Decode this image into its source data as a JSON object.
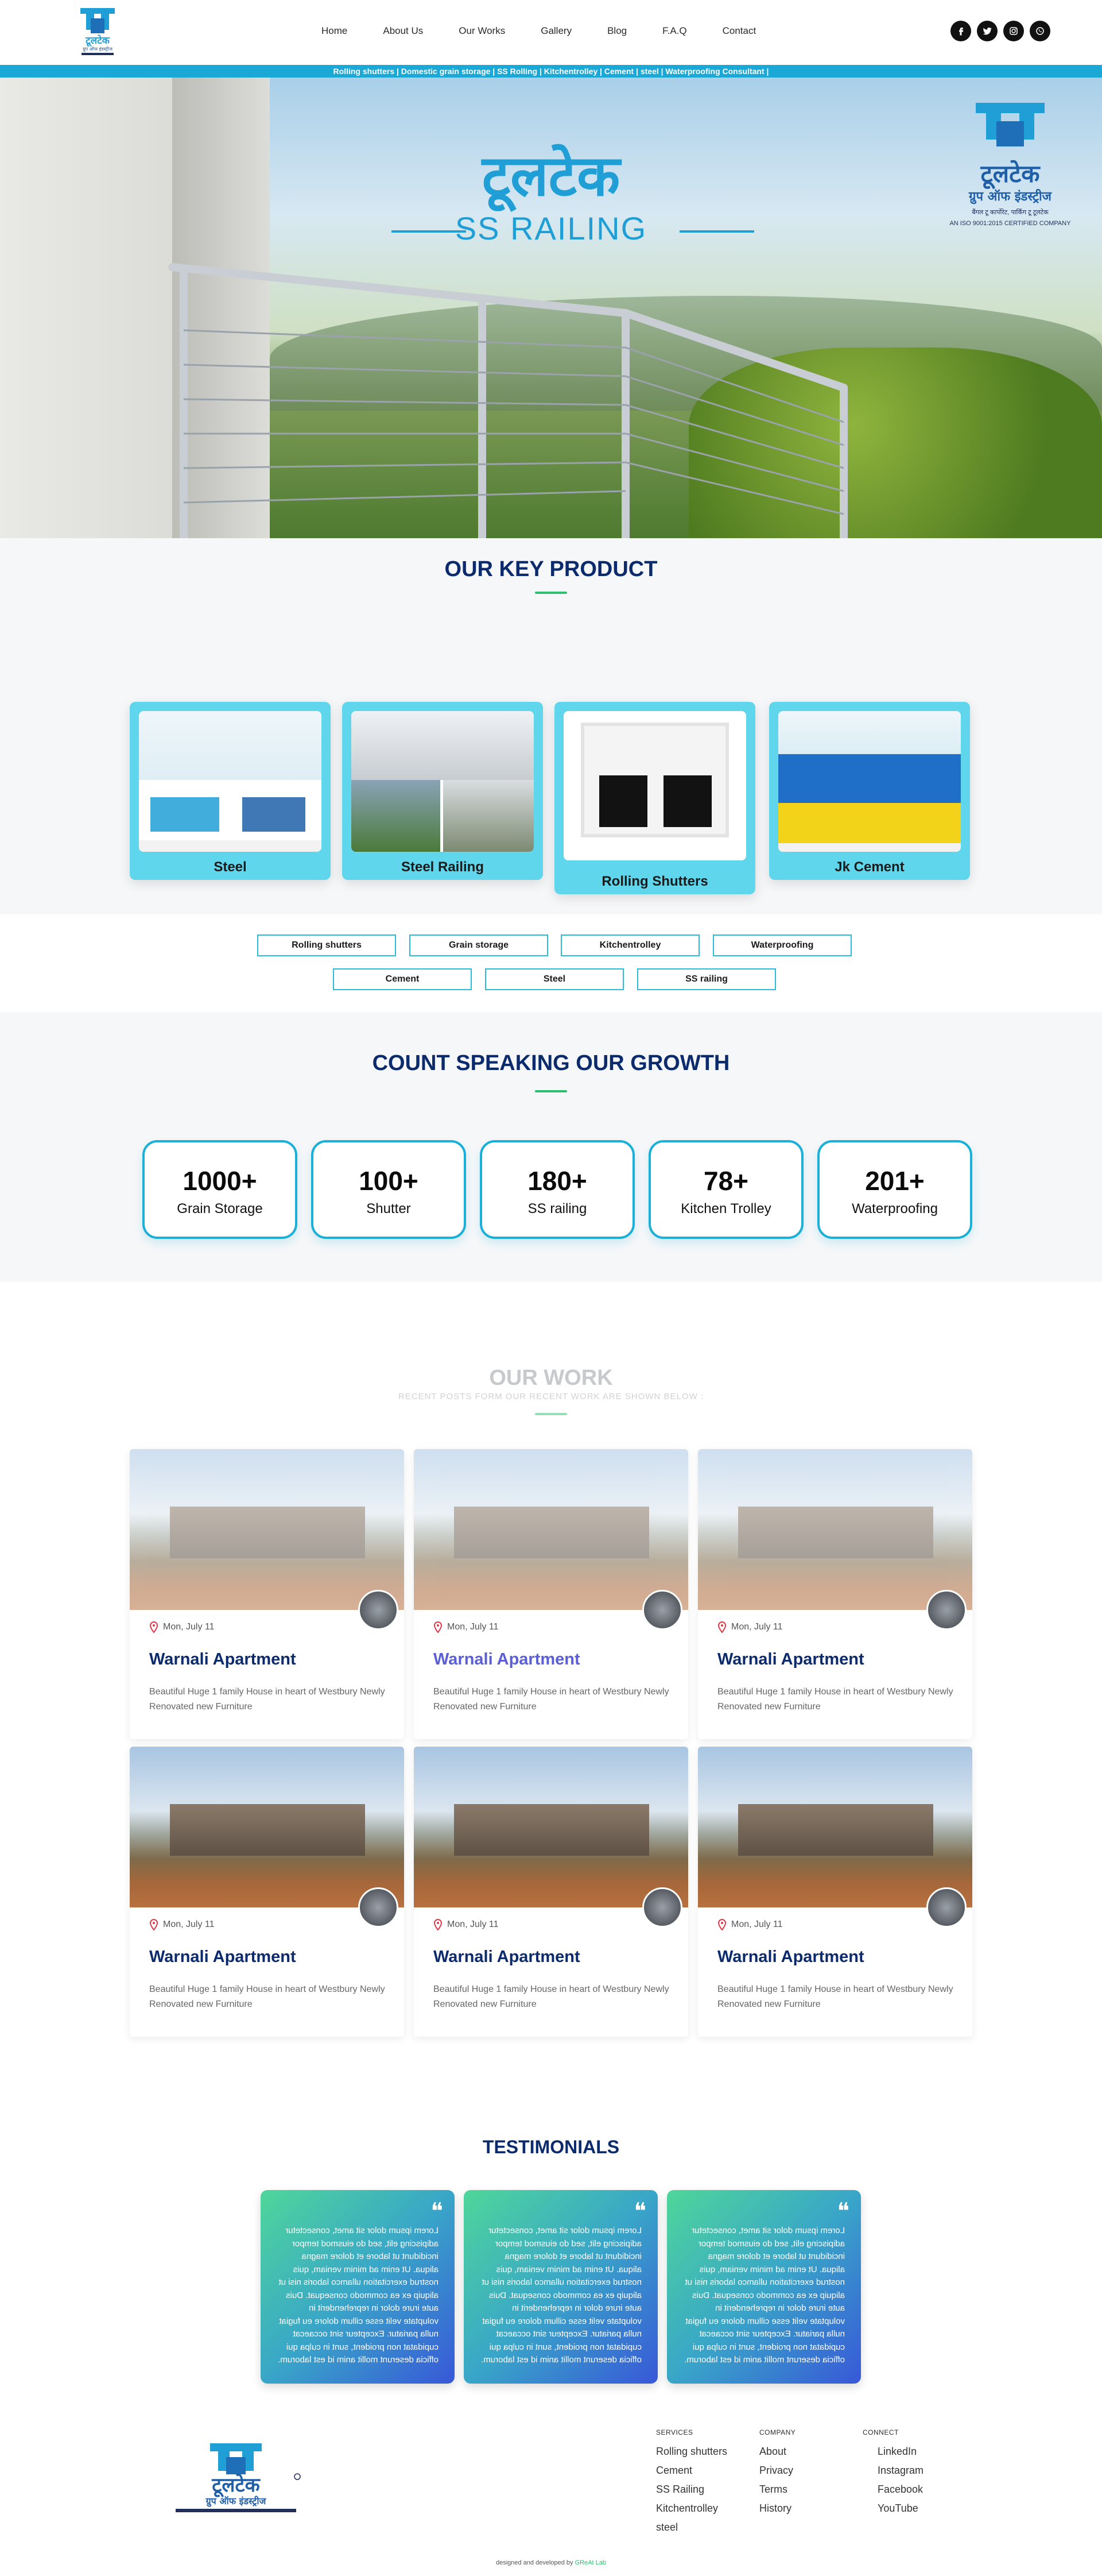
{
  "nav": {
    "items": [
      "Home",
      "About Us",
      "Our Works",
      "Gallery",
      "Blog",
      "F.A.Q",
      "Contact"
    ]
  },
  "social": {
    "icons": [
      "facebook-icon",
      "twitter-icon",
      "instagram-icon",
      "whatsapp-icon"
    ]
  },
  "ticker": {
    "text": "Rolling shutters | Domestic grain storage | SS Rolling | Kitchentrolley | Cement | steel | Waterproofing Consultant |"
  },
  "hero": {
    "title_hi": "टूलटेक",
    "title_en": "SS RAILING",
    "logo_brand_hi": "टूलटेक",
    "logo_group_hi": "ग्रुप ऑफ इंडस्ट्रीज",
    "logo_tagline": "बैंगल टू कार्पोरेट, पार्किंग टू टूलटेक",
    "logo_cert": "AN ISO 9001:2015 CERTIFIED COMPANY"
  },
  "key_product": {
    "title": "OUR KEY PRODUCT",
    "cards": [
      {
        "label": "Steel"
      },
      {
        "label": "Steel Railing"
      },
      {
        "label": "Rolling Shutters"
      },
      {
        "label": "Jk Cement"
      }
    ],
    "chips_row1": [
      "Rolling shutters",
      "Grain storage",
      "Kitchentrolley",
      "Waterproofing"
    ],
    "chips_row2": [
      "Cement",
      "Steel",
      "SS railing"
    ]
  },
  "growth": {
    "title": "COUNT SPEAKING OUR GROWTH",
    "stats": [
      {
        "num": "1000+",
        "label": "Grain Storage"
      },
      {
        "num": "100+",
        "label": "Shutter"
      },
      {
        "num": "180+",
        "label": "SS railing"
      },
      {
        "num": "78+",
        "label": "Kitchen Trolley"
      },
      {
        "num": "201+",
        "label": "Waterproofing"
      }
    ]
  },
  "work": {
    "title": "OUR WORK",
    "subtitle": "RECENT POSTS FORM OUR RECENT WORK ARE SHOWN BELOW :",
    "posts": [
      {
        "date": "Mon, July 11",
        "title": "Warnali Apartment",
        "desc": "Beautiful Huge 1 family House in heart of Westbury Newly Renovated new Furniture"
      },
      {
        "date": "Mon, July 11",
        "title": "Warnali Apartment",
        "desc": "Beautiful Huge 1 family House in heart of Westbury Newly Renovated new Furniture"
      },
      {
        "date": "Mon, July 11",
        "title": "Warnali Apartment",
        "desc": "Beautiful Huge 1 family House in heart of Westbury Newly Renovated new Furniture"
      },
      {
        "date": "Mon, July 11",
        "title": "Warnali Apartment",
        "desc": "Beautiful Huge 1 family House in heart of Westbury Newly Renovated new Furniture"
      },
      {
        "date": "Mon, July 11",
        "title": "Warnali Apartment",
        "desc": "Beautiful Huge 1 family House in heart of Westbury Newly Renovated new Furniture"
      },
      {
        "date": "Mon, July 11",
        "title": "Warnali Apartment",
        "desc": "Beautiful Huge 1 family House in heart of Westbury Newly Renovated new Furniture"
      }
    ]
  },
  "testimonials": {
    "title": "TESTIMONIALS",
    "items": [
      {
        "text": "Lorem ipsum dolor sit amet, consectetur adipiscing elit, sed do eiusmod tempor incididunt ut labore et dolore magna aliqua. Ut enim ad minim veniam, quis nostrud exercitation ullamco laboris nisi ut aliquip ex ea commodo consequat. Duis aute irure dolor in reprehenderit in voluptate velit esse cillum dolore eu fugiat nulla pariatur. Excepteur sint occaecat cupidatat non proident, sunt in culpa qui officia deserunt mollit anim id est laborum."
      },
      {
        "text": "Lorem ipsum dolor sit amet, consectetur adipiscing elit, sed do eiusmod tempor incididunt ut labore et dolore magna aliqua. Ut enim ad minim veniam, quis nostrud exercitation ullamco laboris nisi ut aliquip ex ea commodo consequat. Duis aute irure dolor in reprehenderit in voluptate velit esse cillum dolore eu fugiat nulla pariatur. Excepteur sint occaecat cupidatat non proident, sunt in culpa qui officia deserunt mollit anim id est laborum."
      },
      {
        "text": "Lorem ipsum dolor sit amet, consectetur adipiscing elit, sed do eiusmod tempor incididunt ut labore et dolore magna aliqua. Ut enim ad minim veniam, quis nostrud exercitation ullamco laboris nisi ut aliquip ex ea commodo consequat. Duis aute irure dolor in reprehenderit in voluptate velit esse cillum dolore eu fugiat nulla pariatur. Excepteur sint occaecat cupidatat non proident, sunt in culpa qui officia deserunt mollit anim id est laborum."
      }
    ]
  },
  "footer": {
    "brand_hi": "टूलटेक",
    "group_hi": "ग्रुप ऑफ इंडस्ट्रीज",
    "services": {
      "heading": "SERVICES",
      "links": [
        "Rolling shutters",
        "Cement",
        "SS Railing",
        "Kitchentrolley",
        "steel"
      ]
    },
    "company": {
      "heading": "COMPANY",
      "links": [
        "About",
        "Privacy",
        "Terms",
        "History"
      ]
    },
    "connect": {
      "heading": "CONNECT",
      "links": [
        "LinkedIn",
        "Instagram",
        "Facebook",
        "YouTube"
      ]
    },
    "credit_prefix": "designed and developed by",
    "credit_name": "GReAt Lab"
  },
  "colors": {
    "accent": "#1aa9d6",
    "navy": "#0c2b6d",
    "green": "#2bbf6f",
    "card_cyan": "#5fd6ec"
  }
}
